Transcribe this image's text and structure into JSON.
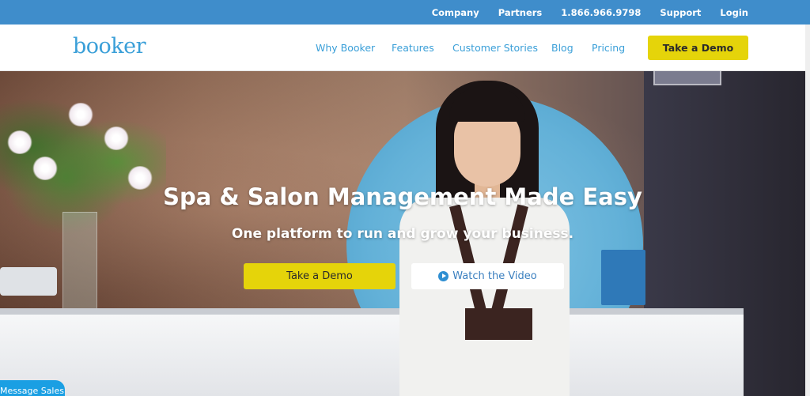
{
  "topbar": {
    "links": [
      "Company",
      "Partners",
      "1.866.966.9798",
      "Support",
      "Login"
    ]
  },
  "header": {
    "logo": "booker",
    "nav": {
      "why": "Why Booker",
      "features": "Features",
      "stories": "Customer Stories",
      "blog": "Blog",
      "pricing": "Pricing"
    },
    "demo_button": "Take a Demo"
  },
  "hero": {
    "title": "Spa & Salon Management Made Easy",
    "subtitle": "One platform to run and grow your business.",
    "demo_button": "Take a Demo",
    "video_button": "Watch the Video"
  },
  "chat": {
    "label": "Message Sales"
  },
  "colors": {
    "topbar": "#3f8dcb",
    "brand": "#3a9fd8",
    "cta_yellow": "#e5d40a",
    "chat_blue": "#1a9fe3"
  },
  "icons": {
    "video": "play-circle-icon"
  }
}
